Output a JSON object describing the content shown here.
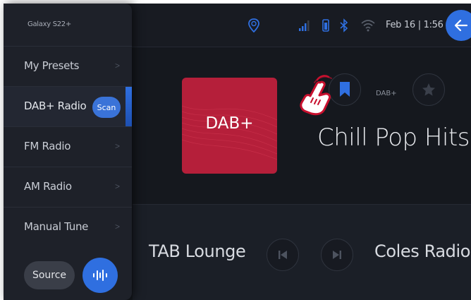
{
  "drawer": {
    "device_name": "Galaxy S22+",
    "items": [
      {
        "label": "My Presets"
      },
      {
        "label": "DAB+ Radio",
        "active": true,
        "badge": "Scan"
      },
      {
        "label": "FM Radio"
      },
      {
        "label": "AM Radio"
      },
      {
        "label": "Manual Tune"
      }
    ],
    "source_label": "Source"
  },
  "status": {
    "time": "Feb 16 | 1:56",
    "icons": [
      "location-pin-icon",
      "signal-icon",
      "battery-icon",
      "bluetooth-icon",
      "wifi-icon"
    ]
  },
  "now_playing": {
    "album_label": "DAB+",
    "band_label": "DAB+",
    "station": "Chill Pop Hits",
    "bookmarked": true
  },
  "bottom": {
    "prev_station": "TAB Lounge",
    "next_station": "Coles Radio"
  },
  "colors": {
    "accent": "#2f6fe0",
    "album": "#b51f3a",
    "hand_outline": "#c8102e"
  }
}
